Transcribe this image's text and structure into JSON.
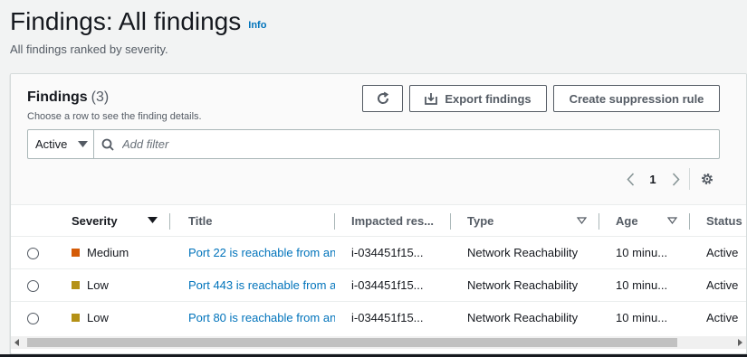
{
  "header": {
    "title": "Findings: All findings",
    "info_label": "Info",
    "description": "All findings ranked by severity."
  },
  "panel": {
    "title": "Findings",
    "count": "(3)",
    "description": "Choose a row to see the finding details.",
    "export_label": "Export findings",
    "suppression_label": "Create suppression rule"
  },
  "filter": {
    "status_value": "Active",
    "placeholder": "Add filter"
  },
  "pagination": {
    "current_page": "1"
  },
  "table": {
    "columns": [
      "Severity",
      "Title",
      "Impacted res...",
      "Type",
      "Age",
      "Status"
    ],
    "rows": [
      {
        "severity": "Medium",
        "severity_color": "#d45b07",
        "title": "Port 22 is reachable from an",
        "resource": "i-034451f15...",
        "type": "Network Reachability",
        "age": "10 minu...",
        "status": "Active"
      },
      {
        "severity": "Low",
        "severity_color": "#b49116",
        "title": "Port 443 is reachable from a",
        "resource": "i-034451f15...",
        "type": "Network Reachability",
        "age": "10 minu...",
        "status": "Active"
      },
      {
        "severity": "Low",
        "severity_color": "#b49116",
        "title": "Port 80 is reachable from an",
        "resource": "i-034451f15...",
        "type": "Network Reachability",
        "age": "10 minu...",
        "status": "Active"
      }
    ]
  },
  "colors": {
    "link": "#0073bb",
    "medium": "#d45b07",
    "low": "#b49116"
  }
}
